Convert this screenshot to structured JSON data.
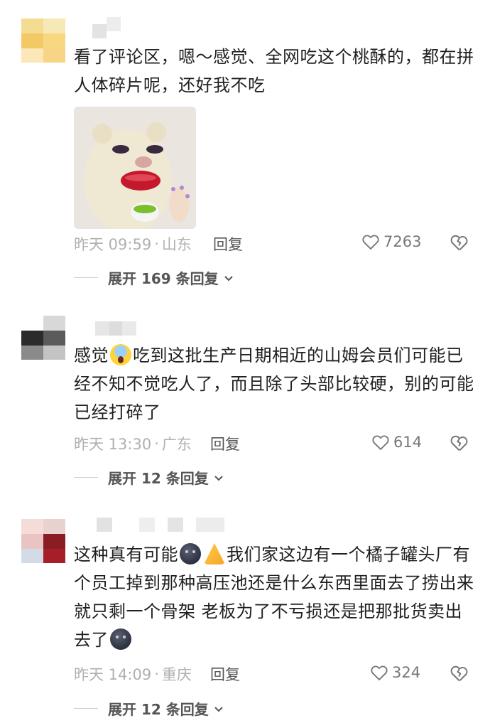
{
  "comments": [
    {
      "text_parts": [
        "看了评论区，嗯～感觉、全网吃这个桃酥的，都在拼人体碎片呢，还好我不吃"
      ],
      "time": "昨天 09:59",
      "location": "山东",
      "reply_label": "回复",
      "likes": "7263",
      "expand_label": "展开 169 条回复"
    },
    {
      "text_parts": [
        "感觉",
        "吃到这批生产日期相近的山姆会员们可能已经不知不觉吃人了，而且除了头部比较硬，别的可能已经打碎了"
      ],
      "time": "昨天 13:30",
      "location": "广东",
      "reply_label": "回复",
      "likes": "614",
      "expand_label": "展开 12 条回复"
    },
    {
      "text_parts": [
        "这种真有可能",
        "我们家这边有一个橘子罐头厂有个员工掉到那种高压池还是什么东西里面去了捞出来就只剩一个骨架 老板为了不亏损还是把那批货卖出去了"
      ],
      "time": "昨天 14:09",
      "location": "重庆",
      "reply_label": "回复",
      "likes": "324",
      "expand_label": "展开 12 条回复"
    }
  ],
  "icons": {
    "like": "heart-outline-icon",
    "dislike": "broken-heart-icon",
    "expand": "chevron-down-icon",
    "emoji_1": "face-screaming-in-fear-emoji",
    "emoji_2": "new-moon-face-emoji",
    "emoji_3": "folded-hands-emoji"
  },
  "colors": {
    "meta_text": "#b0b0b0",
    "body_text": "#1f1f1f",
    "reply_text": "#555555"
  }
}
